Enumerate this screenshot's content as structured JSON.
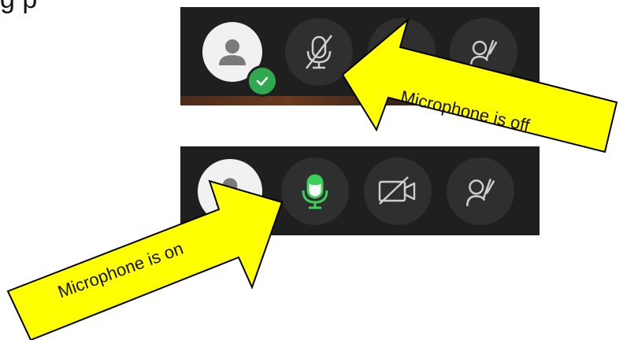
{
  "caption_partial": "g      p",
  "top_bar": {
    "state": "muted",
    "avatar_status": "available"
  },
  "bottom_bar": {
    "state": "unmuted",
    "camera_state": "off"
  },
  "callouts": {
    "off_label": "Microphone is off",
    "on_label": "Microphone is on"
  },
  "icons": {
    "avatar": "person-icon",
    "status": "checkmark-icon",
    "mic_off": "microphone-off-icon",
    "mic_on": "microphone-on-icon",
    "camera_off": "camera-off-icon",
    "raise_hand": "raise-hand-icon"
  },
  "colors": {
    "bar": "#1f1f1f",
    "button": "#2f2f2f",
    "mic_on": "#3ccf5a",
    "status_green": "#2fa84f",
    "callout_fill": "#ffff00"
  }
}
